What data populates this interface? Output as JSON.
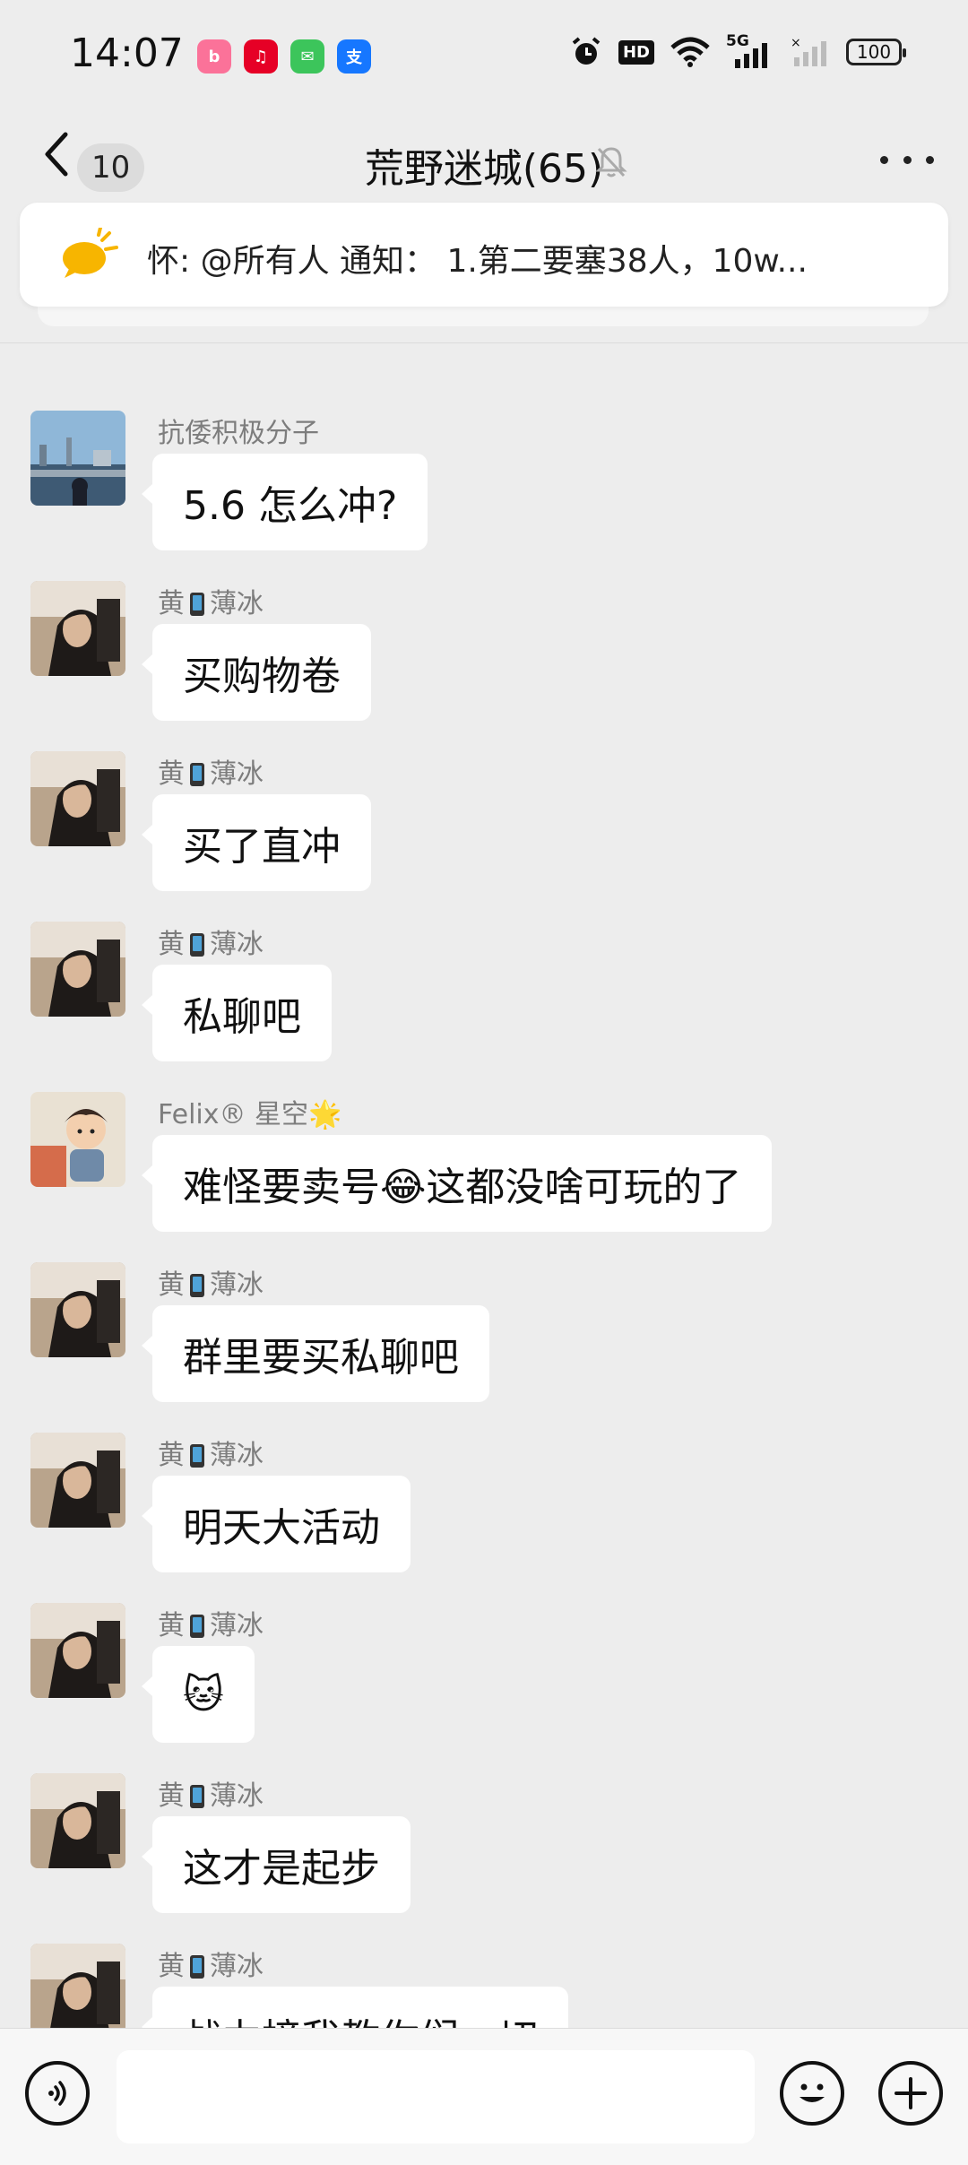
{
  "status_bar": {
    "time": "14:07",
    "app_icons": [
      {
        "name": "bilibili-icon",
        "color": "#fb7299",
        "glyph": "b"
      },
      {
        "name": "netease-music-icon",
        "color": "#e60026",
        "glyph": "♫"
      },
      {
        "name": "messages-icon",
        "color": "#3cc55b",
        "glyph": "✉"
      },
      {
        "name": "alipay-icon",
        "color": "#1677ff",
        "glyph": "支"
      }
    ],
    "hd_label": "HD",
    "network_label": "5G",
    "battery": "100"
  },
  "nav": {
    "unread_count": "10",
    "title": "荒野迷城(65)"
  },
  "notice": {
    "text": "怀: @所有人 通知：  1.第二要塞38人，10w..."
  },
  "messages": [
    {
      "sender": "抗倭积极分子",
      "text": "5.6 怎么冲?",
      "avatar": "city"
    },
    {
      "sender_parts": [
        "黄",
        "薄冰"
      ],
      "text": "买购物卷",
      "avatar": "person"
    },
    {
      "sender_parts": [
        "黄",
        "薄冰"
      ],
      "text": "买了直冲",
      "avatar": "person"
    },
    {
      "sender_parts": [
        "黄",
        "薄冰"
      ],
      "text": "私聊吧",
      "avatar": "person"
    },
    {
      "sender": "Felix® 星空🌟",
      "text": "难怪要卖号😂这都没啥可玩的了",
      "avatar": "cartoon"
    },
    {
      "sender_parts": [
        "黄",
        "薄冰"
      ],
      "text": "群里要买私聊吧",
      "avatar": "person"
    },
    {
      "sender_parts": [
        "黄",
        "薄冰"
      ],
      "text": "明天大活动",
      "avatar": "person"
    },
    {
      "sender_parts": [
        "黄",
        "薄冰"
      ],
      "text": "🐱",
      "avatar": "person"
    },
    {
      "sender_parts": [
        "黄",
        "薄冰"
      ],
      "text": "这才是起步",
      "avatar": "person"
    },
    {
      "sender_parts": [
        "黄",
        "薄冰"
      ],
      "text": "战力榜我教你们一切",
      "avatar": "person"
    }
  ],
  "input": {
    "placeholder": ""
  }
}
